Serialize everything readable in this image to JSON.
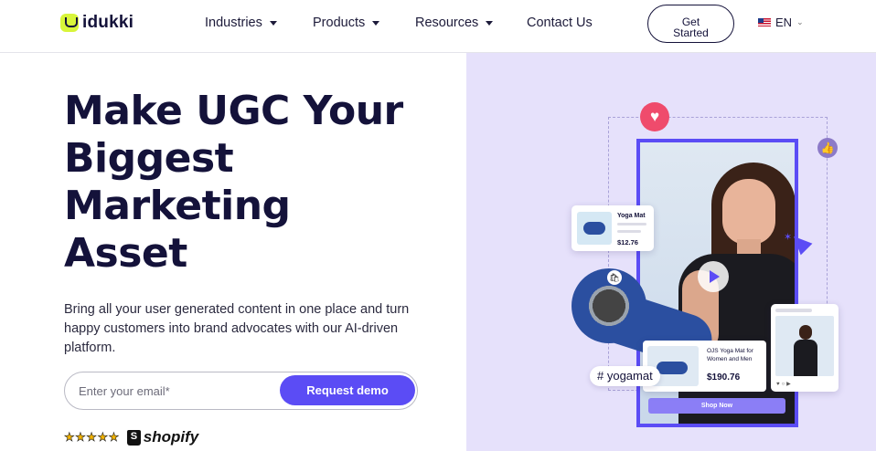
{
  "nav": {
    "logo_text": "idukki",
    "items": [
      {
        "label": "Industries"
      },
      {
        "label": "Products"
      },
      {
        "label": "Resources"
      },
      {
        "label": "Contact Us"
      }
    ],
    "cta_line1": "Get",
    "cta_line2": "Started",
    "language": "EN"
  },
  "hero": {
    "headline_lines": [
      "Make UGC Your",
      "Biggest",
      "Marketing",
      "Asset"
    ],
    "subtitle": "Bring all your user generated content in one place and turn happy customers into brand advocates with our AI-driven platform.",
    "email_placeholder": "Enter your email*",
    "demo_button": "Request demo",
    "stars": "★★★★★",
    "shopify_label": "shopify"
  },
  "visual": {
    "product_card": {
      "title": "Yoga Mat",
      "price": "$12.76"
    },
    "ojs_card": {
      "title": "OJS Yoga Mat for Women and Men",
      "price": "$190.76"
    },
    "hashtag": "# yogamat",
    "shop_now": "Shop Now"
  },
  "colors": {
    "accent": "#5b4cf5",
    "hero_bg": "#e6e1fb",
    "heading": "#14123a",
    "logo_mark": "#d8f53a",
    "heart": "#ef4b6c"
  },
  "icons": [
    "logo-mark-icon",
    "caret-down-icon",
    "us-flag-icon",
    "chevron-down-icon",
    "heart-icon",
    "thumbs-up-icon",
    "cursor-icon",
    "play-icon",
    "shopping-bag-icon",
    "shopify-bag-icon",
    "star-icon"
  ]
}
